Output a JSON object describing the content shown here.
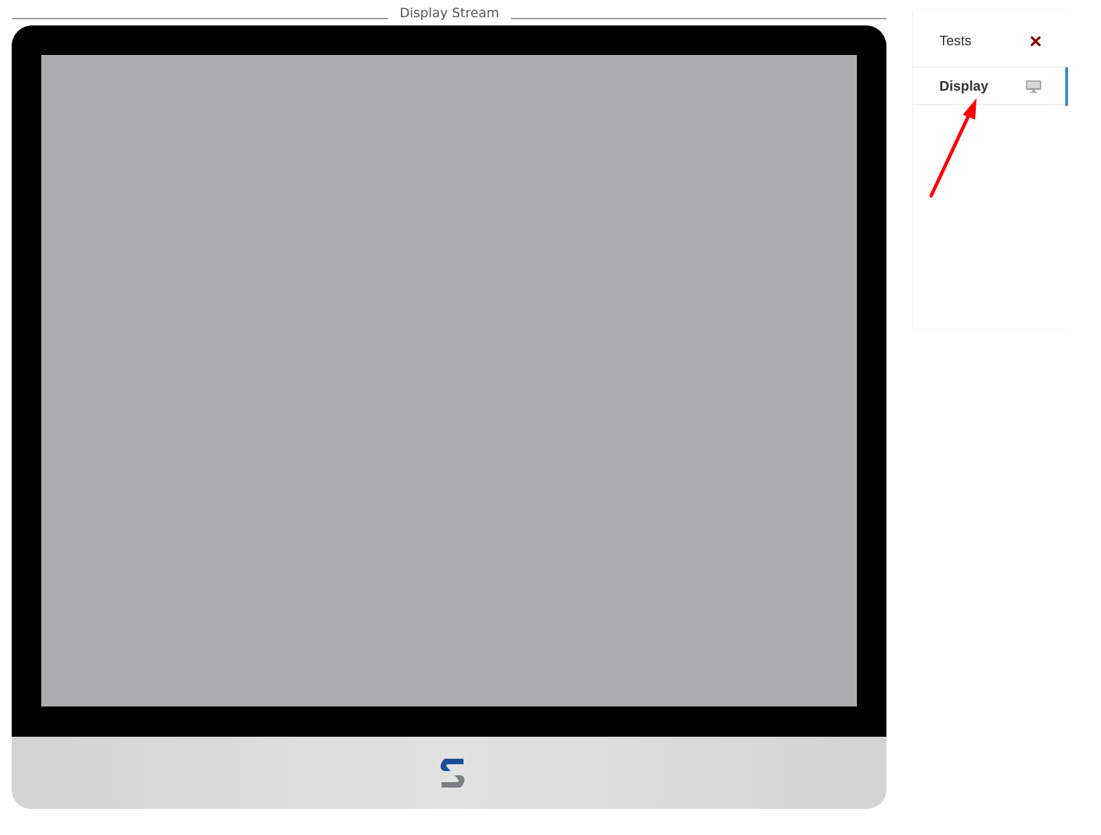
{
  "stream": {
    "title": "Display Stream"
  },
  "monitor": {
    "logo_icon": "brand-s-logo",
    "colors": {
      "bezel": "#000000",
      "screen": "#adacaf",
      "logo_top": "#1f4e96",
      "logo_bottom": "#7b7f84"
    }
  },
  "sidebar": {
    "items": [
      {
        "label": "Tests",
        "icon": "close-x-icon",
        "icon_color": "#8b0000",
        "active": false
      },
      {
        "label": "Display",
        "icon": "monitor-icon",
        "icon_color": "#9a9a9a",
        "active": true
      }
    ],
    "active_color": "#3a87c8"
  },
  "annotation": {
    "type": "arrow",
    "color": "#ff0000",
    "points_to": "Display"
  }
}
